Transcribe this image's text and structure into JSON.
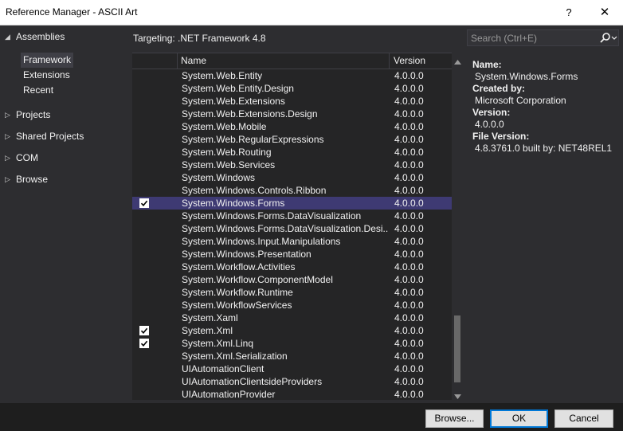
{
  "window": {
    "title": "Reference Manager - ASCII Art",
    "help_label": "?",
    "close_label": "✕"
  },
  "nav": {
    "assemblies": "Assemblies",
    "assemblies_items": [
      "Framework",
      "Extensions",
      "Recent"
    ],
    "projects": "Projects",
    "shared_projects": "Shared Projects",
    "com": "COM",
    "browse": "Browse"
  },
  "targeting": "Targeting: .NET Framework 4.8",
  "search": {
    "placeholder": "Search (Ctrl+E)"
  },
  "list": {
    "columns": {
      "name": "Name",
      "version": "Version"
    },
    "rows": [
      {
        "name": "System.Web.Entity",
        "version": "4.0.0.0",
        "checked": false,
        "selected": false
      },
      {
        "name": "System.Web.Entity.Design",
        "version": "4.0.0.0",
        "checked": false,
        "selected": false
      },
      {
        "name": "System.Web.Extensions",
        "version": "4.0.0.0",
        "checked": false,
        "selected": false
      },
      {
        "name": "System.Web.Extensions.Design",
        "version": "4.0.0.0",
        "checked": false,
        "selected": false
      },
      {
        "name": "System.Web.Mobile",
        "version": "4.0.0.0",
        "checked": false,
        "selected": false
      },
      {
        "name": "System.Web.RegularExpressions",
        "version": "4.0.0.0",
        "checked": false,
        "selected": false
      },
      {
        "name": "System.Web.Routing",
        "version": "4.0.0.0",
        "checked": false,
        "selected": false
      },
      {
        "name": "System.Web.Services",
        "version": "4.0.0.0",
        "checked": false,
        "selected": false
      },
      {
        "name": "System.Windows",
        "version": "4.0.0.0",
        "checked": false,
        "selected": false
      },
      {
        "name": "System.Windows.Controls.Ribbon",
        "version": "4.0.0.0",
        "checked": false,
        "selected": false
      },
      {
        "name": "System.Windows.Forms",
        "version": "4.0.0.0",
        "checked": true,
        "selected": true
      },
      {
        "name": "System.Windows.Forms.DataVisualization",
        "version": "4.0.0.0",
        "checked": false,
        "selected": false
      },
      {
        "name": "System.Windows.Forms.DataVisualization.Desi...",
        "version": "4.0.0.0",
        "checked": false,
        "selected": false
      },
      {
        "name": "System.Windows.Input.Manipulations",
        "version": "4.0.0.0",
        "checked": false,
        "selected": false
      },
      {
        "name": "System.Windows.Presentation",
        "version": "4.0.0.0",
        "checked": false,
        "selected": false
      },
      {
        "name": "System.Workflow.Activities",
        "version": "4.0.0.0",
        "checked": false,
        "selected": false
      },
      {
        "name": "System.Workflow.ComponentModel",
        "version": "4.0.0.0",
        "checked": false,
        "selected": false
      },
      {
        "name": "System.Workflow.Runtime",
        "version": "4.0.0.0",
        "checked": false,
        "selected": false
      },
      {
        "name": "System.WorkflowServices",
        "version": "4.0.0.0",
        "checked": false,
        "selected": false
      },
      {
        "name": "System.Xaml",
        "version": "4.0.0.0",
        "checked": false,
        "selected": false
      },
      {
        "name": "System.Xml",
        "version": "4.0.0.0",
        "checked": true,
        "selected": false
      },
      {
        "name": "System.Xml.Linq",
        "version": "4.0.0.0",
        "checked": true,
        "selected": false
      },
      {
        "name": "System.Xml.Serialization",
        "version": "4.0.0.0",
        "checked": false,
        "selected": false
      },
      {
        "name": "UIAutomationClient",
        "version": "4.0.0.0",
        "checked": false,
        "selected": false
      },
      {
        "name": "UIAutomationClientsideProviders",
        "version": "4.0.0.0",
        "checked": false,
        "selected": false
      },
      {
        "name": "UIAutomationProvider",
        "version": "4.0.0.0",
        "checked": false,
        "selected": false
      }
    ]
  },
  "details": {
    "name_label": "Name:",
    "name_value": "System.Windows.Forms",
    "created_by_label": "Created by:",
    "created_by_value": "Microsoft Corporation",
    "version_label": "Version:",
    "version_value": "4.0.0.0",
    "file_version_label": "File Version:",
    "file_version_value": "4.8.3761.0 built by: NET48REL1"
  },
  "buttons": {
    "browse": "Browse...",
    "ok": "OK",
    "cancel": "Cancel"
  },
  "colors": {
    "background": "#2d2d30",
    "list_background": "#252526",
    "selection": "#3e3a73",
    "footer": "#1e1e1e"
  }
}
